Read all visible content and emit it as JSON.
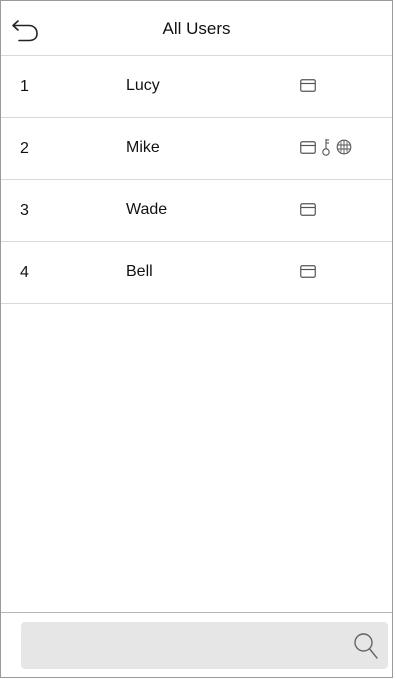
{
  "header": {
    "title": "All Users",
    "back_icon": "back-arrow-icon"
  },
  "users": [
    {
      "id": "1",
      "name": "Lucy",
      "verify_icons": [
        "card-icon"
      ]
    },
    {
      "id": "2",
      "name": "Mike",
      "verify_icons": [
        "card-icon",
        "password-key-icon",
        "face-icon"
      ]
    },
    {
      "id": "3",
      "name": "Wade",
      "verify_icons": [
        "card-icon"
      ]
    },
    {
      "id": "4",
      "name": "Bell",
      "verify_icons": [
        "card-icon"
      ]
    }
  ],
  "search": {
    "value": "",
    "placeholder": "",
    "icon": "search-icon"
  },
  "colors": {
    "divider": "#d9d9d9",
    "search_bg": "#e6e6e6",
    "icon_stroke": "#555555"
  }
}
